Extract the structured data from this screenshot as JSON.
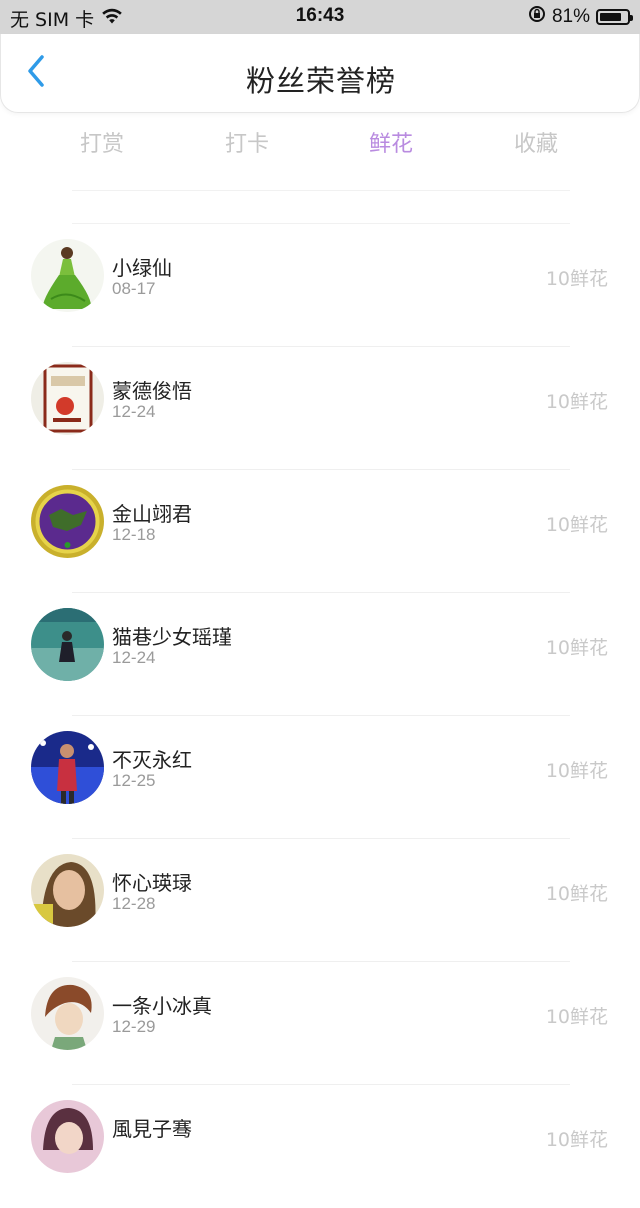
{
  "status_bar": {
    "carrier": "无 SIM 卡",
    "time": "16:43",
    "battery": "81%",
    "battery_level": 0.81
  },
  "header": {
    "title": "粉丝荣誉榜",
    "back_icon": "chevron-left-icon",
    "accent_color": "#2f9be8"
  },
  "tabs": [
    {
      "label": "打赏",
      "active": false
    },
    {
      "label": "打卡",
      "active": false
    },
    {
      "label": "鲜花",
      "active": true
    },
    {
      "label": "收藏",
      "active": false
    }
  ],
  "active_tab_color": "#b98be0",
  "fans": [
    {
      "name": "小绿仙",
      "date": "08-17",
      "amount": "10鲜花",
      "avatar": "green-dress-avatar"
    },
    {
      "name": "蒙德俊悟",
      "date": "12-24",
      "amount": "10鲜花",
      "avatar": "cartoon-card-avatar"
    },
    {
      "name": "金山翊君",
      "date": "12-18",
      "amount": "10鲜花",
      "avatar": "purple-emblem-avatar"
    },
    {
      "name": "猫巷少女瑶瑾",
      "date": "12-24",
      "amount": "10鲜花",
      "avatar": "teal-girl-avatar"
    },
    {
      "name": "不灭永红",
      "date": "12-25",
      "amount": "10鲜花",
      "avatar": "stage-singer-avatar"
    },
    {
      "name": "怀心瑛琭",
      "date": "12-28",
      "amount": "10鲜花",
      "avatar": "woman-portrait-avatar"
    },
    {
      "name": "一条小冰真",
      "date": "12-29",
      "amount": "10鲜花",
      "avatar": "anime-boy-avatar"
    },
    {
      "name": "風見子骞",
      "date": "",
      "amount": "10鲜花",
      "avatar": "pink-portrait-avatar"
    }
  ]
}
